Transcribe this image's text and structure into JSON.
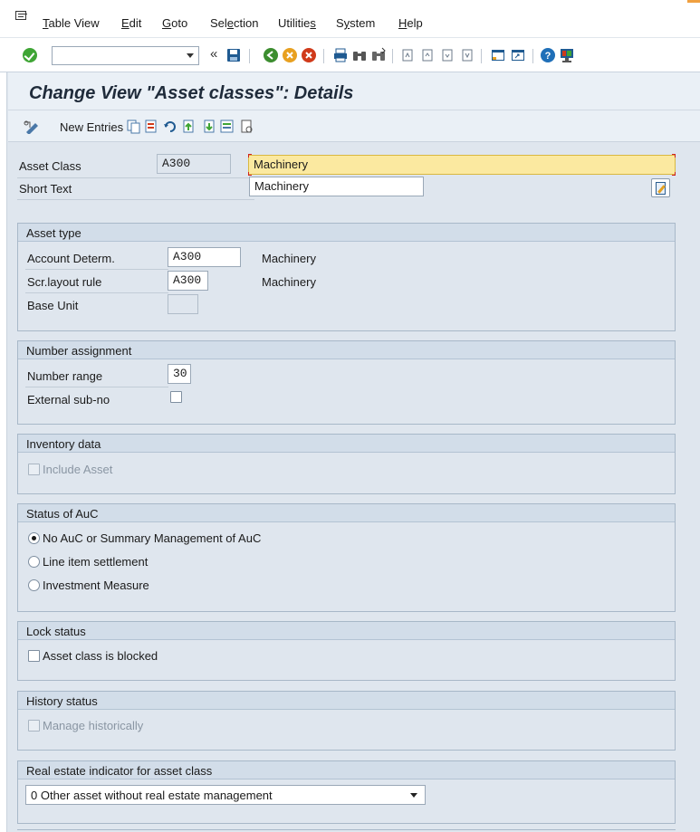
{
  "menu": {
    "items": [
      {
        "label": "Table View",
        "left": "T",
        "rest": "able View"
      },
      {
        "label": "Edit",
        "left": "E",
        "rest": "dit"
      },
      {
        "label": "Goto",
        "left": "G",
        "rest": "oto"
      },
      {
        "label": "Selection",
        "left": "",
        "rest": ""
      },
      {
        "label": "Utilities",
        "left": "",
        "rest": ""
      },
      {
        "label": "System",
        "left": "",
        "rest": ""
      },
      {
        "label": "Help",
        "left": "H",
        "rest": "elp"
      }
    ],
    "selection_a": "Sel",
    "selection_b": "e",
    "selection_c": "ction",
    "utilities_a": "Utilitie",
    "utilities_b": "s",
    "system_a": "S",
    "system_b": "y",
    "system_c": "stem"
  },
  "toolbar": {
    "command_value": "",
    "back_glyph": "«"
  },
  "title": "Change View \"Asset classes\": Details",
  "app_toolbar": {
    "new_entries_label": "New Entries"
  },
  "header_fields": {
    "asset_class_label": "Asset Class",
    "asset_class_value": "A300",
    "asset_class_desc": "Machinery",
    "short_text_label": "Short Text",
    "short_text_value": "Machinery"
  },
  "groups": {
    "asset_type": {
      "title": "Asset type",
      "account_determ_label": "Account Determ.",
      "account_determ_value": "A300",
      "account_determ_desc": "Machinery",
      "scr_layout_label": "Scr.layout rule",
      "scr_layout_value": "A300",
      "scr_layout_desc": "Machinery",
      "base_unit_label": "Base Unit",
      "base_unit_value": ""
    },
    "number_assignment": {
      "title": "Number assignment",
      "number_range_label": "Number range",
      "number_range_value": "30",
      "external_subno_label": "External sub-no",
      "external_subno_checked": false
    },
    "inventory": {
      "title": "Inventory data",
      "include_asset_label": "Include Asset",
      "include_asset_checked": false
    },
    "auc_status": {
      "title": "Status of AuC",
      "options": [
        {
          "label": "No AuC or Summary Management of AuC",
          "selected": true
        },
        {
          "label": "Line item settlement",
          "selected": false
        },
        {
          "label": "Investment Measure",
          "selected": false
        }
      ]
    },
    "lock_status": {
      "title": "Lock status",
      "blocked_label": "Asset class is blocked",
      "blocked_checked": false
    },
    "history_status": {
      "title": "History status",
      "manage_hist_label": "Manage historically",
      "manage_hist_checked": false
    },
    "real_estate": {
      "title": "Real estate indicator for asset class",
      "selected_value": "0 Other asset without real estate management"
    }
  },
  "colors": {
    "ok_green": "#3fa535",
    "required_yellow": "#fbe9a0",
    "group_header": "#d2dde9",
    "background": "#dfe6ee"
  },
  "icons": [
    "menu-icon",
    "enter-icon",
    "back-arrows-icon",
    "save-icon",
    "back-icon",
    "exit-icon",
    "cancel-icon",
    "print-icon",
    "find-icon",
    "find-next-icon",
    "first-page-icon",
    "previous-page-icon",
    "next-page-icon",
    "last-page-icon",
    "create-session-icon",
    "shortcut-icon",
    "help-icon",
    "customize-layout-icon",
    "display-change-icon",
    "copy-as-icon",
    "delete-icon",
    "undo-change-icon",
    "previous-entry-icon",
    "next-entry-icon",
    "select-all-icon",
    "transport-icon",
    "edit-text-icon"
  ]
}
